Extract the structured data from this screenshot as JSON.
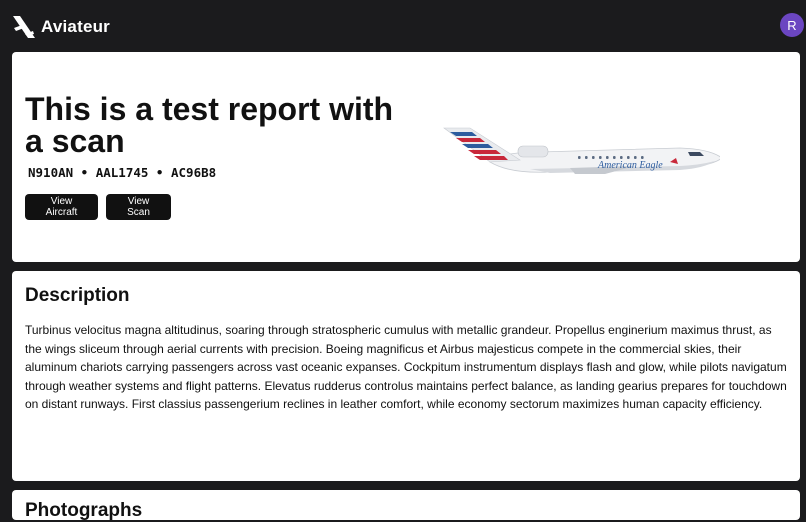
{
  "app": {
    "brand_name": "Aviateur",
    "logo_icon": "plane-logo-icon",
    "avatar_initial": "R",
    "avatar_color": "#6b46c1"
  },
  "report": {
    "title": "This is a test report with a scan",
    "identifiers": "N910AN • AAL1745 • AC96B8",
    "view_aircraft_label": "View Aircraft",
    "view_scan_label": "View Scan",
    "aircraft_image": "american-eagle-regional-jet",
    "aircraft_livery_text": "American Eagle"
  },
  "description": {
    "heading": "Description",
    "body": "Turbinus velocitus magna altitudinus, soaring through stratospheric cumulus with metallic grandeur. Propellus enginerium maximus thrust, as the wings sliceum through aerial currents with precision. Boeing magnificus et Airbus majesticus compete in the commercial skies, their aluminum chariots carrying passengers across vast oceanic expanses. Cockpitum instrumentum displays flash and glow, while pilots navigatum through weather systems and flight patterns. Elevatus rudderus controlus maintains perfect balance, as landing gearius prepares for touchdown on distant runways. First classius passengerium reclines in leather comfort, while economy sectorum maximizes human capacity efficiency."
  },
  "next_section": {
    "heading": "Photographs"
  }
}
